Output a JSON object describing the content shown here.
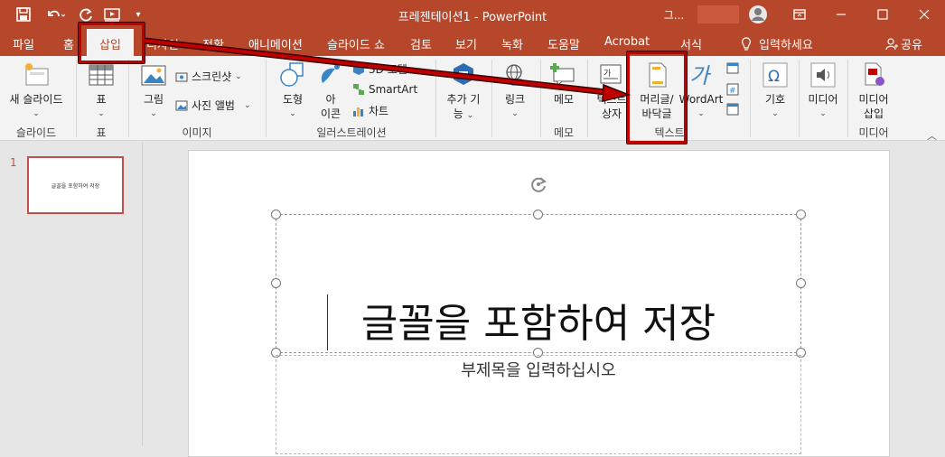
{
  "titlebar": {
    "title": "프레젠테이션1 - PowerPoint",
    "user_initial": "그..."
  },
  "tabs": {
    "file": "파일",
    "home": "홈",
    "insert": "삽입",
    "design": "디자인",
    "transitions": "전환",
    "animations": "애니메이션",
    "slideshow": "슬라이드 쇼",
    "review": "검토",
    "view": "보기",
    "record": "녹화",
    "help": "도움말",
    "acrobat": "Acrobat",
    "format": "서식",
    "tellme": "입력하세요",
    "share": "공유"
  },
  "ribbon": {
    "new_slide": "새 슬라이드",
    "group_slides": "슬라이드",
    "table": "표",
    "group_table": "표",
    "picture": "그림",
    "screenshot": "스크린샷",
    "photo_album": "사진 앨범",
    "group_images": "이미지",
    "shapes": "도형",
    "icons": "아이콘",
    "icons_line1": "아",
    "icons_line2": "이콘",
    "models3d": "3D 모델",
    "smartart": "SmartArt",
    "chart": "차트",
    "group_illustrations": "일러스트레이션",
    "addins": "추가 기능",
    "addins_line1": "추가 기",
    "addins_line2": "능",
    "link": "링크",
    "comment": "메모",
    "group_comment": "메모",
    "textbox": "텍스트 상자",
    "textbox_line1": "텍스트",
    "textbox_line2": "상자",
    "header_footer_line1": "머리글/",
    "header_footer_line2": "바닥글",
    "wordart": "WordArt",
    "group_text": "텍스트",
    "symbols": "기호",
    "media": "미디어",
    "media_insert_line1": "미디어",
    "media_insert_line2": "삽입",
    "group_media": "미디어"
  },
  "thumbnail": {
    "number": "1",
    "text": "글꼴을 포함하여 저장"
  },
  "slide": {
    "title": "글꼴을 포함하여 저장",
    "subtitle_placeholder": "부제목을 입력하십시오"
  },
  "colors": {
    "accent": "#b7472a",
    "highlight": "#c00000"
  }
}
